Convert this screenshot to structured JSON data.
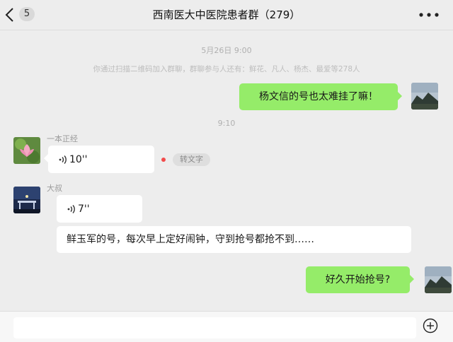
{
  "header": {
    "unread_count": "5",
    "title": "西南医大中医院患者群（279）"
  },
  "timeline": {
    "date_time": "5月26日  9:00",
    "system_message": "你通过扫描二维码加入群聊，群聊参与人还有：鲜花、凡人、杨杰、最爱等278人",
    "time_separator": "9:10"
  },
  "messages": {
    "me_1": "杨文信的号也太难挂了嘛！",
    "user1_name": "一本正经",
    "user1_voice": "10''",
    "user1_convert": "转文字",
    "user2_name": "大叔",
    "user2_voice": "7''",
    "user2_text": "鲜玉军的号，每次早上定好闹钟，守到抢号都抢不到……",
    "me_2": "好久开始抢号?"
  },
  "input": {
    "value": ""
  },
  "colors": {
    "background": "#ededed",
    "my_bubble": "#95ec69",
    "other_bubble": "#ffffff",
    "unread_dot": "#f24b4b"
  }
}
